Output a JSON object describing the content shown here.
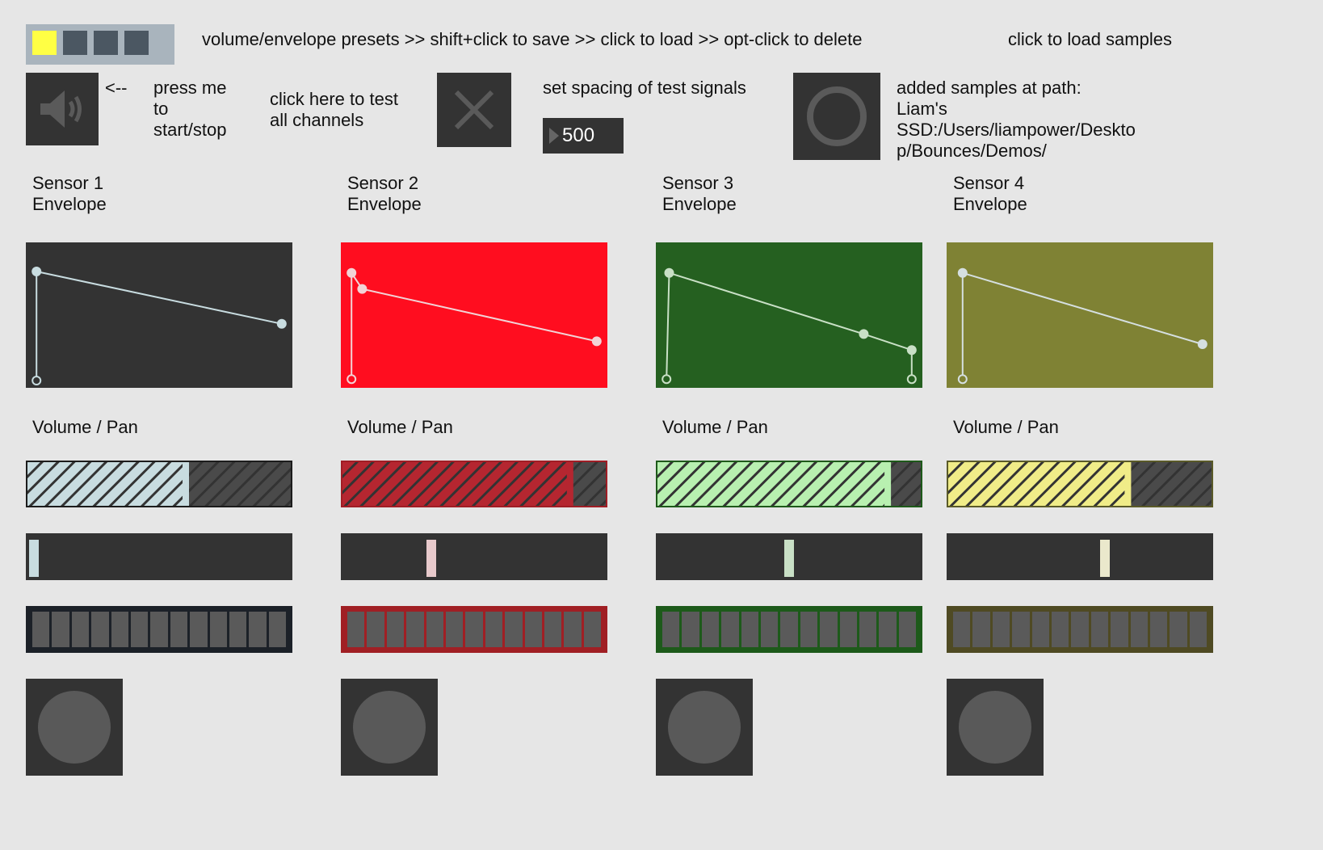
{
  "header": {
    "presets_hint": "volume/envelope presets >> shift+click to save >> click to load >> opt-click to delete",
    "load_samples_label": "click to load samples"
  },
  "presets": {
    "slots": [
      {
        "active": true,
        "color": "#ffff44"
      },
      {
        "active": false,
        "color": "#4b5762"
      },
      {
        "active": false,
        "color": "#4b5762"
      },
      {
        "active": false,
        "color": "#4b5762"
      }
    ]
  },
  "controls": {
    "arrow_label": "<--",
    "start_stop_label": "press me\nto\nstart/stop",
    "test_channels_label": "click here to test\nall channels",
    "spacing_label": "set spacing of test signals",
    "spacing_value": "500",
    "samples_path_label": "added samples at path:\nLiam's\nSSD:/Users/liampower/Deskto\np/Bounces/Demos/"
  },
  "sensors": [
    {
      "title": "Sensor 1\nEnvelope",
      "vp_label": "Volume / Pan",
      "bg": "#333333",
      "line": "#c8dce0",
      "vol_fill": "#c8dce0",
      "vol_border": "#1c1c1c",
      "volume": 0.6,
      "pan": 0.0,
      "pan_color": "#c8dce0",
      "steps_bg": "#1c2128",
      "envelope": [
        [
          0.04,
          0.95
        ],
        [
          0.04,
          0.2
        ],
        [
          0.96,
          0.56
        ]
      ]
    },
    {
      "title": "Sensor 2\nEnvelope",
      "vp_label": "Volume / Pan",
      "bg": "#ff0d1f",
      "line": "#f2d3d6",
      "vol_fill": "#b52630",
      "vol_border": "#a01d25",
      "volume": 0.86,
      "pan": 0.33,
      "pan_color": "#e8cacc",
      "steps_bg": "#a01f24",
      "envelope": [
        [
          0.04,
          0.94
        ],
        [
          0.04,
          0.21
        ],
        [
          0.08,
          0.32
        ],
        [
          0.96,
          0.68
        ]
      ]
    },
    {
      "title": "Sensor 3\nEnvelope",
      "vp_label": "Volume / Pan",
      "bg": "#256020",
      "line": "#c9e0c6",
      "vol_fill": "#b8f0b0",
      "vol_border": "#1e5a1a",
      "volume": 0.87,
      "pan": 0.5,
      "pan_color": "#c9e0c6",
      "steps_bg": "#1d5a1a",
      "envelope": [
        [
          0.04,
          0.94
        ],
        [
          0.05,
          0.21
        ],
        [
          0.78,
          0.63
        ],
        [
          0.96,
          0.74
        ],
        [
          0.96,
          0.94
        ]
      ]
    },
    {
      "title": "Sensor 4\nEnvelope",
      "vp_label": "Volume / Pan",
      "bg": "#7f8234",
      "line": "#d5dfe0",
      "vol_fill": "#f0ec88",
      "vol_border": "#5a5a28",
      "volume": 0.68,
      "pan": 0.6,
      "pan_color": "#eae8cc",
      "steps_bg": "#4f4a23",
      "envelope": [
        [
          0.06,
          0.94
        ],
        [
          0.06,
          0.21
        ],
        [
          0.96,
          0.7
        ]
      ]
    }
  ]
}
